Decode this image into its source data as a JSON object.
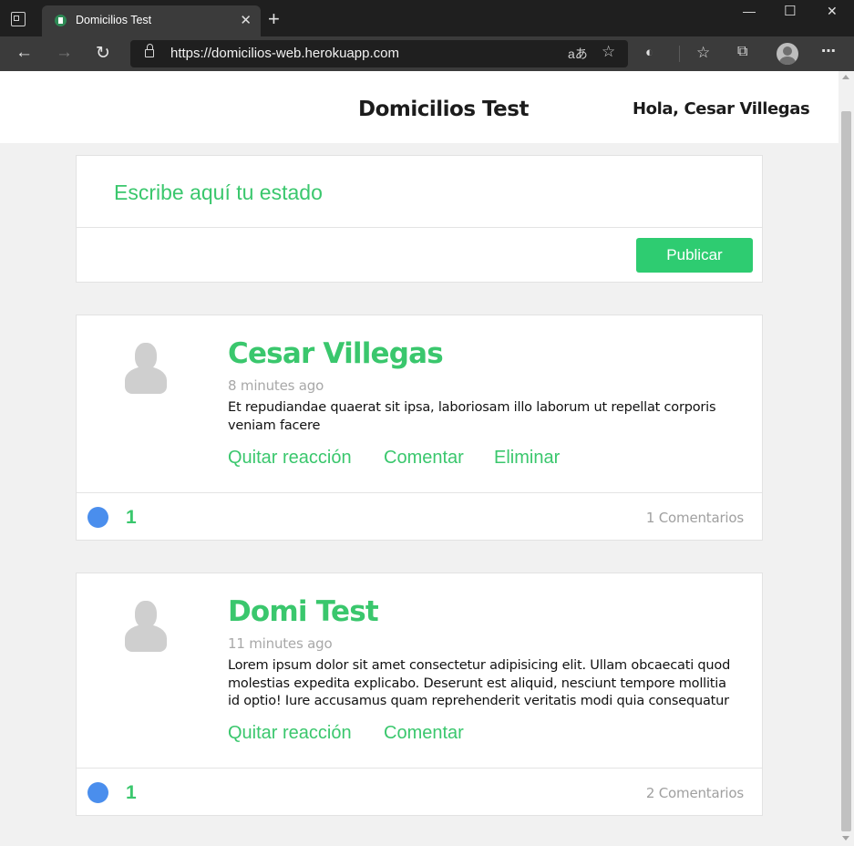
{
  "browser": {
    "tab_title": "Domicilios Test",
    "tab_close_glyph": "✕",
    "new_tab_glyph": "+",
    "url": "https://domicilios-web.herokuapp.com",
    "window_controls": [
      "—",
      "☐",
      "✕"
    ],
    "icons": [
      "tab-actions-icon",
      "back-icon",
      "forward-icon",
      "refresh-icon",
      "lock-icon",
      "translate-icon",
      "add-favorite-icon",
      "tracking-prevention-icon",
      "favorites-icon",
      "collections-icon",
      "profile-icon",
      "more-icon"
    ]
  },
  "header": {
    "title": "Domicilios Test",
    "greeting": "Hola, Cesar Villegas"
  },
  "composer": {
    "placeholder": "Escribe aquí tu estado",
    "publish_label": "Publicar",
    "accent_color": "#2ecc71"
  },
  "posts": [
    {
      "author": "Cesar Villegas",
      "time": "8 minutes ago",
      "body": "Et repudiandae quaerat sit ipsa, laboriosam illo laborum ut repellat corporis veniam facere",
      "actions": [
        "Quitar reacción",
        "Comentar",
        "Eliminar"
      ],
      "reaction_count": "1",
      "comments": "1 Comentarios"
    },
    {
      "author": "Domi Test",
      "time": "11 minutes ago",
      "body": "Lorem ipsum dolor sit amet consectetur adipisicing elit. Ullam obcaecati quod molestias expedita explicabo. Deserunt est aliquid, nesciunt tempore mollitia id optio! Iure accusamus quam reprehenderit veritatis modi quia consequatur",
      "actions": [
        "Quitar reacción",
        "Comentar"
      ],
      "reaction_count": "1",
      "comments": "2 Comentarios"
    }
  ],
  "colors": {
    "green": "#3ac76d",
    "reaction_blue": "#4a8eed",
    "background": "#f1f1f1"
  }
}
